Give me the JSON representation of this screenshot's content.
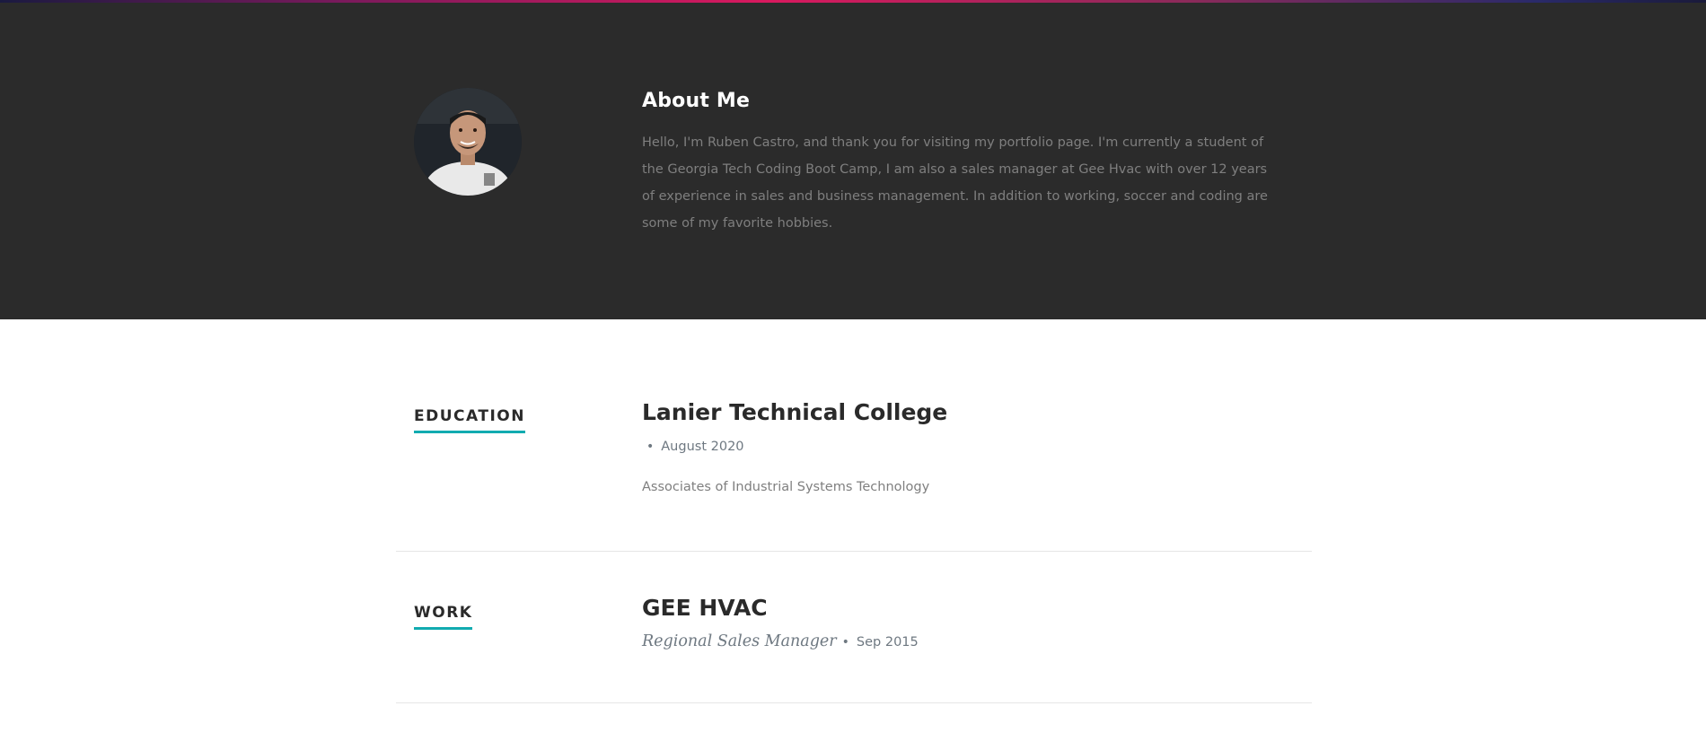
{
  "about": {
    "title": "About Me",
    "text": "Hello, I'm Ruben Castro, and thank you for visiting my portfolio page. I'm currently a student of the Georgia Tech Coding Boot Camp, I am also a sales manager at Gee Hvac with over 12 years of experience in sales and business management. In addition to working, soccer and coding are some of my favorite hobbies."
  },
  "education": {
    "label": "EDUCATION",
    "school": "Lanier Technical College",
    "date": "August 2020",
    "description": "Associates of Industrial Systems Technology"
  },
  "work": {
    "label": "WORK",
    "company": "GEE HVAC",
    "role": "Regional Sales Manager",
    "date": "Sep 2015"
  },
  "colors": {
    "accent": "#11abb0",
    "about_bg": "#2b2b2b",
    "heading": "#2a2a2a"
  }
}
